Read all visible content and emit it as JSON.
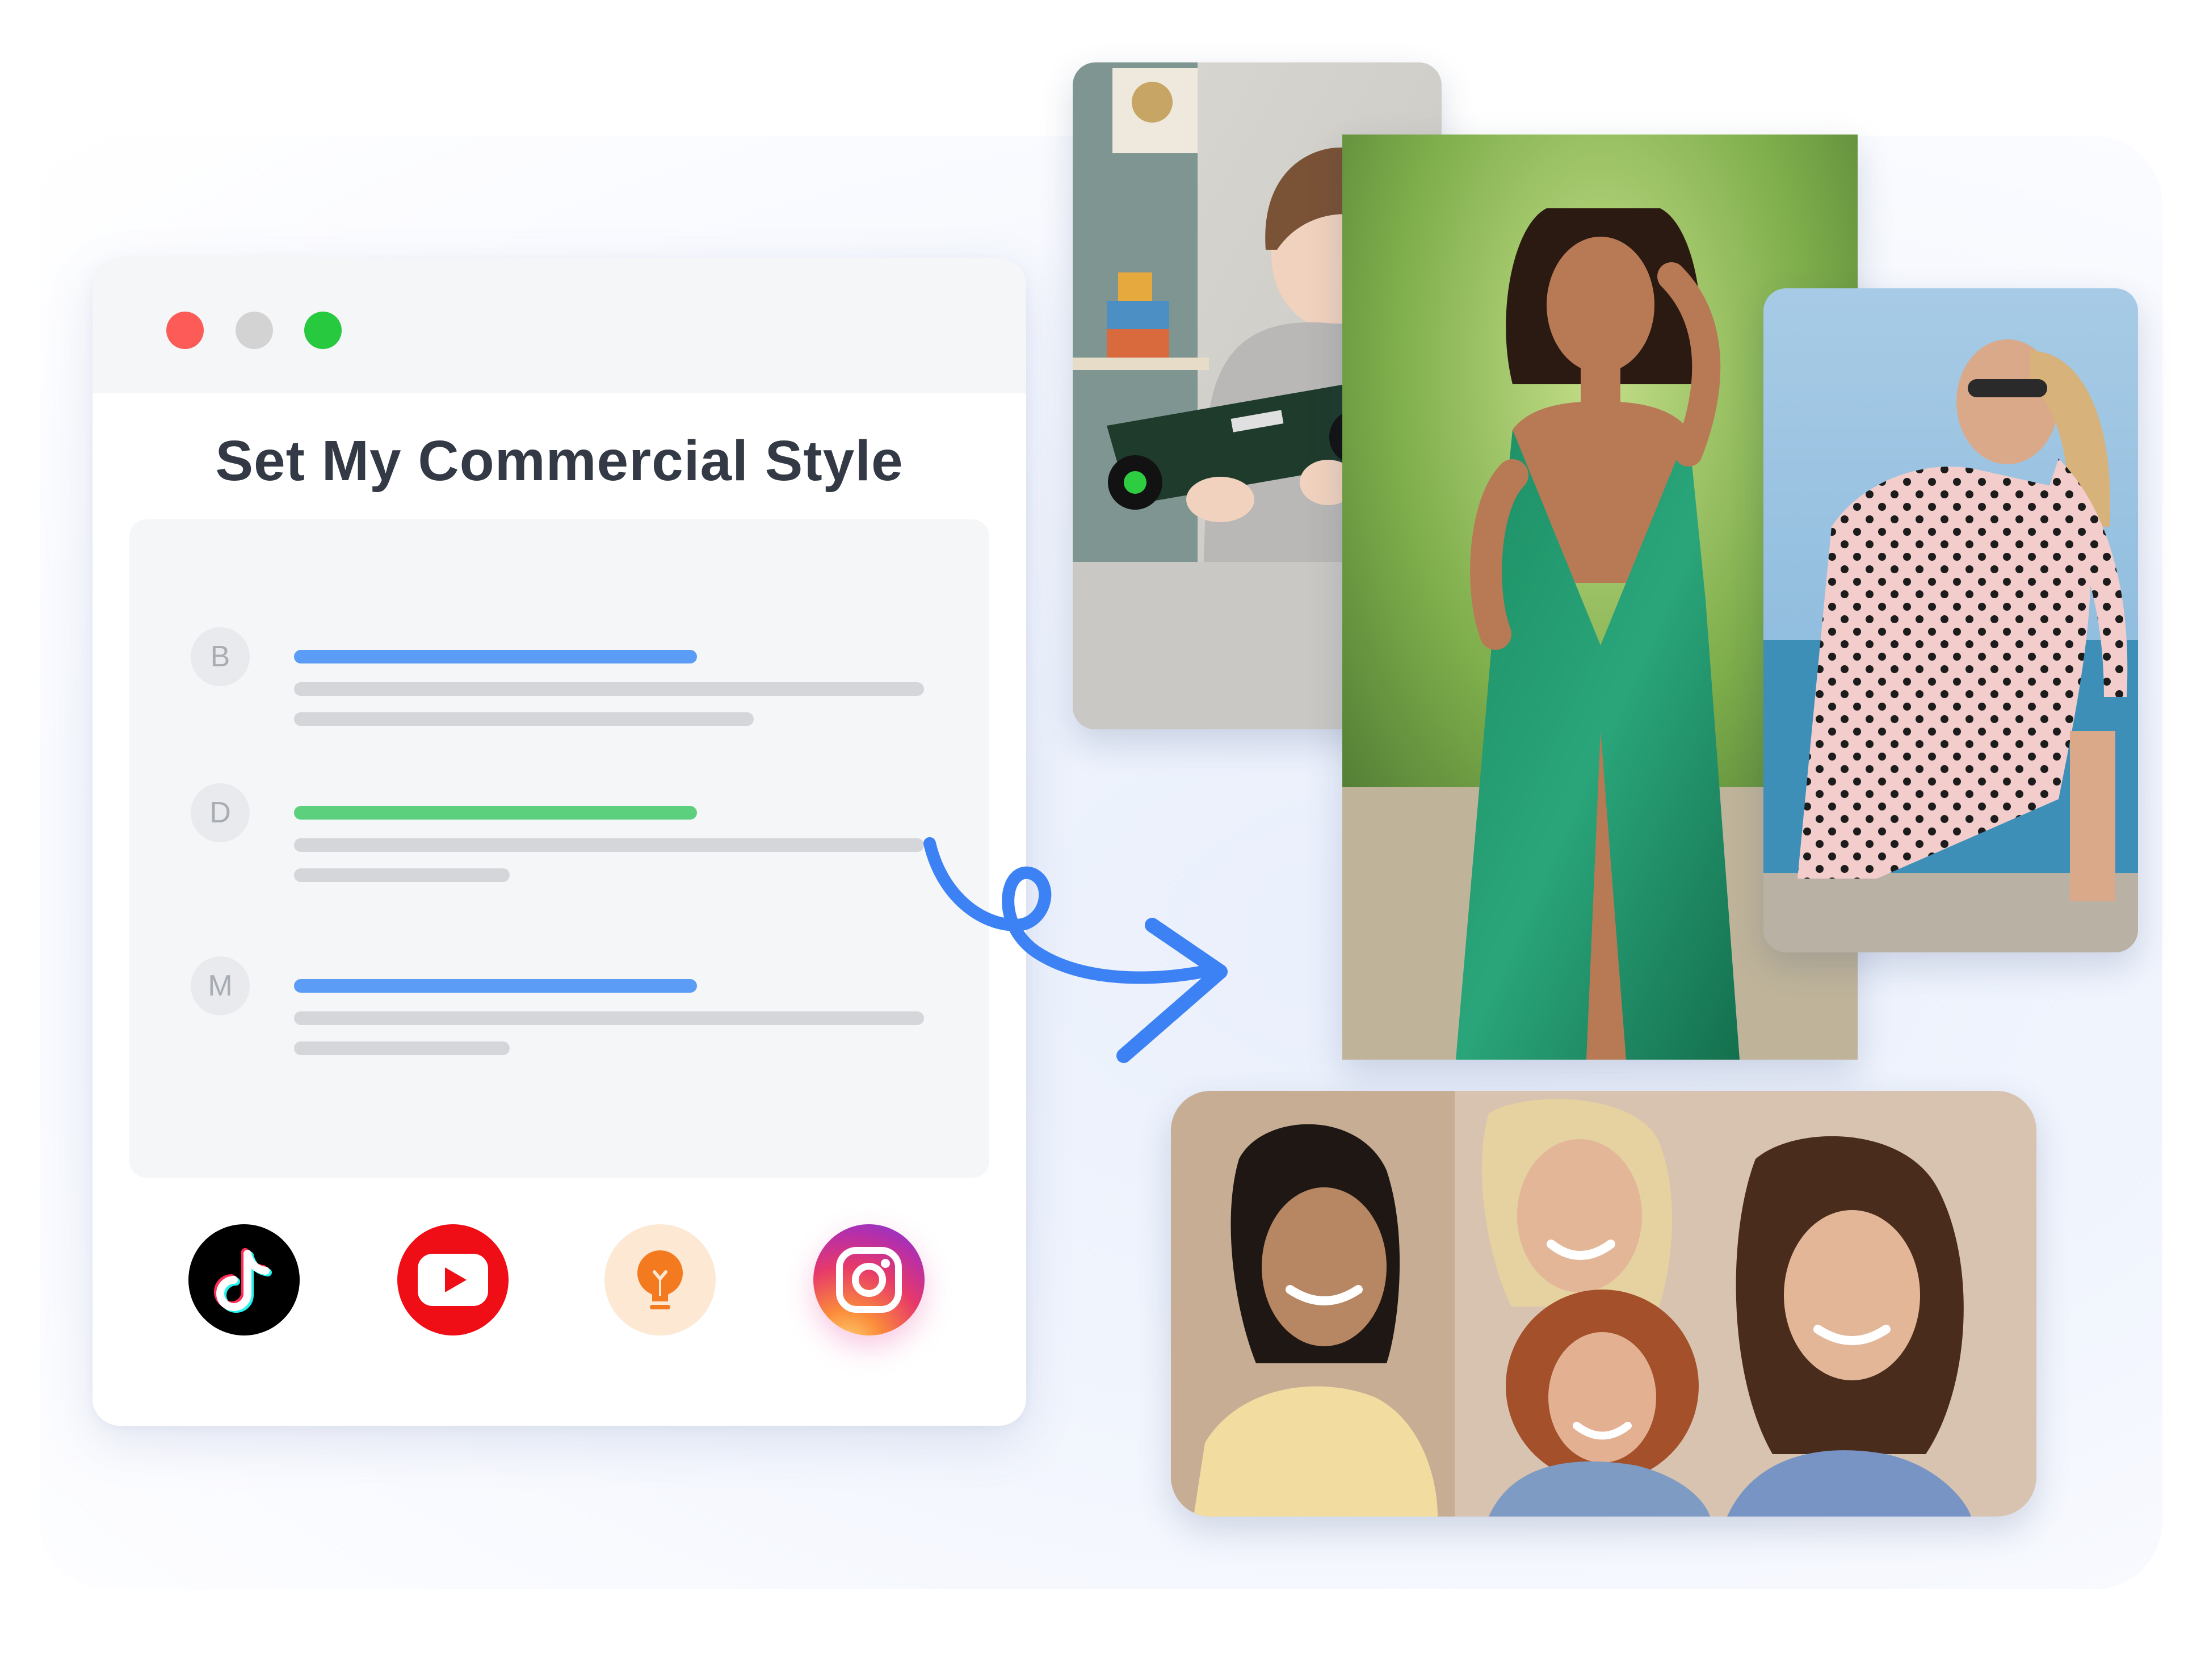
{
  "window": {
    "title": "Set My Commercial Style",
    "controls": [
      "close",
      "minimize",
      "maximize"
    ]
  },
  "style_options": [
    {
      "letter": "B",
      "accent_color": "#5b9cf6"
    },
    {
      "letter": "D",
      "accent_color": "#5cd07d"
    },
    {
      "letter": "M",
      "accent_color": "#5b9cf6"
    }
  ],
  "platforms": [
    {
      "name": "tiktok-icon",
      "bg": "#000000"
    },
    {
      "name": "youtube-icon",
      "bg": "#ef0e16"
    },
    {
      "name": "lightbulb-icon",
      "bg": "#fde8d4"
    },
    {
      "name": "instagram-icon",
      "bg": "gradient"
    }
  ],
  "photos": [
    {
      "name": "photo-toy-review"
    },
    {
      "name": "photo-green-dress"
    },
    {
      "name": "photo-polka-dress"
    },
    {
      "name": "photo-friends-group"
    }
  ],
  "colors": {
    "accent_blue": "#5b9cf6",
    "accent_green": "#5cd07d",
    "title_text": "#333a45"
  }
}
